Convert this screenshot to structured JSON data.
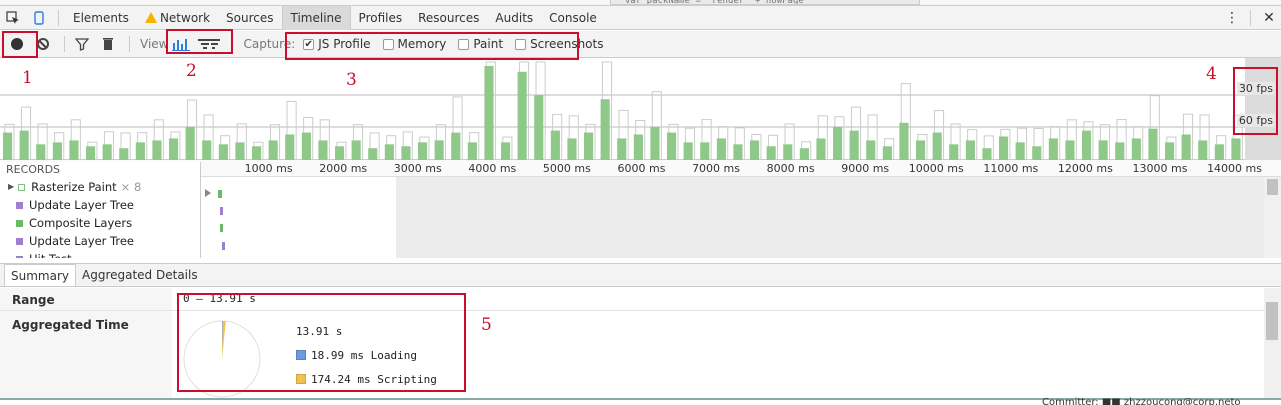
{
  "tabs": [
    "Elements",
    "Network",
    "Sources",
    "Timeline",
    "Profiles",
    "Resources",
    "Audits",
    "Console"
  ],
  "active_tab": "Timeline",
  "toolbar": {
    "view_label": "View",
    "capture_label": "Capture:",
    "capture_options": [
      {
        "label": "JS Profile",
        "checked": true
      },
      {
        "label": "Memory",
        "checked": false
      },
      {
        "label": "Paint",
        "checked": false
      },
      {
        "label": "Screenshots",
        "checked": false
      }
    ]
  },
  "overview": {
    "fps_30": "30 fps",
    "fps_60": "60 fps",
    "bar_color": "#8ec98a",
    "bar_heights": [
      0.28,
      0.3,
      0.16,
      0.18,
      0.2,
      0.14,
      0.16,
      0.12,
      0.18,
      0.2,
      0.22,
      0.34,
      0.2,
      0.16,
      0.18,
      0.14,
      0.2,
      0.26,
      0.28,
      0.2,
      0.14,
      0.2,
      0.12,
      0.16,
      0.14,
      0.18,
      0.2,
      0.28,
      0.18,
      0.96,
      0.18,
      0.9,
      0.66,
      0.3,
      0.22,
      0.28,
      0.62,
      0.22,
      0.26,
      0.34,
      0.28,
      0.18,
      0.18,
      0.22,
      0.16,
      0.2,
      0.14,
      0.16,
      0.12,
      0.22,
      0.34,
      0.3,
      0.2,
      0.14,
      0.38,
      0.2,
      0.28,
      0.16,
      0.2,
      0.12,
      0.24,
      0.18,
      0.14,
      0.22,
      0.2,
      0.3,
      0.2,
      0.18,
      0.22,
      0.32,
      0.18,
      0.26,
      0.2,
      0.16,
      0.22
    ]
  },
  "ruler_ticks": [
    "1000 ms",
    "2000 ms",
    "3000 ms",
    "4000 ms",
    "5000 ms",
    "6000 ms",
    "7000 ms",
    "8000 ms",
    "9000 ms",
    "10000 ms",
    "11000 ms",
    "12000 ms",
    "13000 ms",
    "14000 ms"
  ],
  "records": {
    "header": "RECORDS",
    "items": [
      {
        "label": "Rasterize Paint",
        "count": "× 8",
        "color": "#7fbf7f",
        "outline": true,
        "expandable": true
      },
      {
        "label": "Update Layer Tree",
        "color": "#9d7fd0"
      },
      {
        "label": "Composite Layers",
        "color": "#6aba6a"
      },
      {
        "label": "Update Layer Tree",
        "color": "#9d7fd0"
      },
      {
        "label": "Hit Test",
        "color": "#9d7fd0"
      }
    ]
  },
  "summary_tabs": [
    "Summary",
    "Aggregated Details"
  ],
  "summary": {
    "range_label": "Range",
    "range_value": "0 – 13.91 s",
    "aggregated_label": "Aggregated Time",
    "total": "13.91 s",
    "legend": [
      {
        "label": "18.99 ms Loading",
        "color": "#6a9be0"
      },
      {
        "label": "174.24 ms Scripting",
        "color": "#f2c24f"
      }
    ]
  },
  "footer_text": "Committer: ■■ zhzzoucong@corp.neto",
  "annotations": [
    "1",
    "2",
    "3",
    "4",
    "5"
  ]
}
